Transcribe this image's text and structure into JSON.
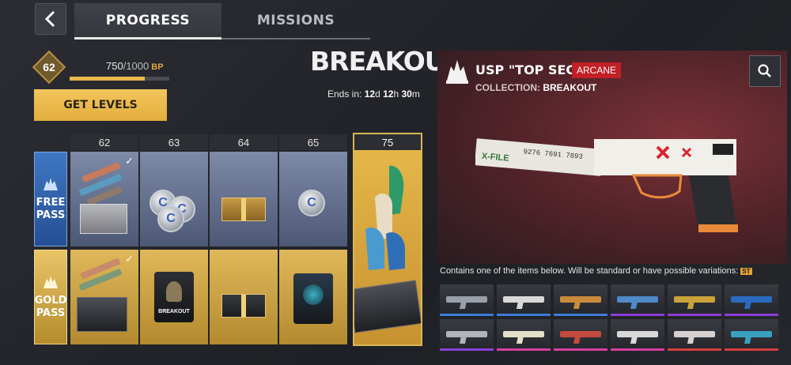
{
  "nav": {
    "back_label": "‹",
    "tabs": [
      {
        "label": "PROGRESS",
        "active": true
      },
      {
        "label": "MISSIONS",
        "active": false
      }
    ]
  },
  "level": {
    "current": "62",
    "bp_current": "750",
    "bp_max": "1000",
    "bp_unit": "BP",
    "progress": 0.75
  },
  "get_levels_label": "GET LEVELS",
  "season": {
    "title": "BREAKOUT",
    "ends_in_label": "Ends in:",
    "days": "12",
    "hours": "12",
    "minutes": "30"
  },
  "passes": {
    "free_label": [
      "FREE",
      "PASS"
    ],
    "gold_label": [
      "GOLD",
      "PASS"
    ]
  },
  "levels": [
    "62",
    "63",
    "64",
    "65",
    "75"
  ],
  "free_rewards": [
    {
      "level": "62",
      "type": "weapon-crate",
      "claimed": true
    },
    {
      "level": "63",
      "type": "coins",
      "claimed": false
    },
    {
      "level": "64",
      "type": "gift-box",
      "claimed": false
    },
    {
      "level": "65",
      "type": "coins",
      "claimed": false
    }
  ],
  "gold_rewards": [
    {
      "level": "62",
      "type": "weapon-case",
      "claimed": true
    },
    {
      "level": "63",
      "type": "character-bag",
      "bag_text": "BREAKOUT",
      "claimed": false
    },
    {
      "level": "64",
      "type": "gift-box",
      "claimed": false
    },
    {
      "level": "65",
      "type": "lucky-bag",
      "claimed": false
    }
  ],
  "reward_75": {
    "level": "75",
    "type": "gloves-and-case"
  },
  "item_panel": {
    "name": "USP \"TOP SECRET\"",
    "rarity": "ARCANE",
    "collection_label": "COLLECTION:",
    "collection_value": "BREAKOUT",
    "gun_decal_text": "X-FILE",
    "gun_numbers": "9276 7691 7893",
    "rarity_color": "#c21f26"
  },
  "contains_text": "Contains one of the items below. Will be standard or have possible variations:",
  "contains_badge": "ST",
  "variants": [
    {
      "weapon": "smg",
      "rarity_color": "#3f7bd8",
      "skin": "#9aa0a8"
    },
    {
      "weapon": "rifle",
      "rarity_color": "#3f7bd8",
      "skin": "#d9d9d9"
    },
    {
      "weapon": "shotgun",
      "rarity_color": "#3f7bd8",
      "skin": "#c98a3e"
    },
    {
      "weapon": "rifle",
      "rarity_color": "#8a3fd8",
      "skin": "#4f8ac9"
    },
    {
      "weapon": "pistol",
      "rarity_color": "#8a3fd8",
      "skin": "#c9a23a"
    },
    {
      "weapon": "smg",
      "rarity_color": "#8a3fd8",
      "skin": "#2a6bc0"
    },
    {
      "weapon": "rifle",
      "rarity_color": "#8a3fd8",
      "skin": "#b0b3b8"
    },
    {
      "weapon": "pistol",
      "rarity_color": "#d83fa0",
      "skin": "#e3dfc9"
    },
    {
      "weapon": "smg",
      "rarity_color": "#d83fa0",
      "skin": "#c24a3e"
    },
    {
      "weapon": "rifle",
      "rarity_color": "#d83fa0",
      "skin": "#d8d8d8"
    },
    {
      "weapon": "pistol",
      "rarity_color": "#d83f3f",
      "skin": "#d8cfd0"
    },
    {
      "weapon": "smg",
      "rarity_color": "#d83f3f",
      "skin": "#3aa0c0"
    }
  ]
}
